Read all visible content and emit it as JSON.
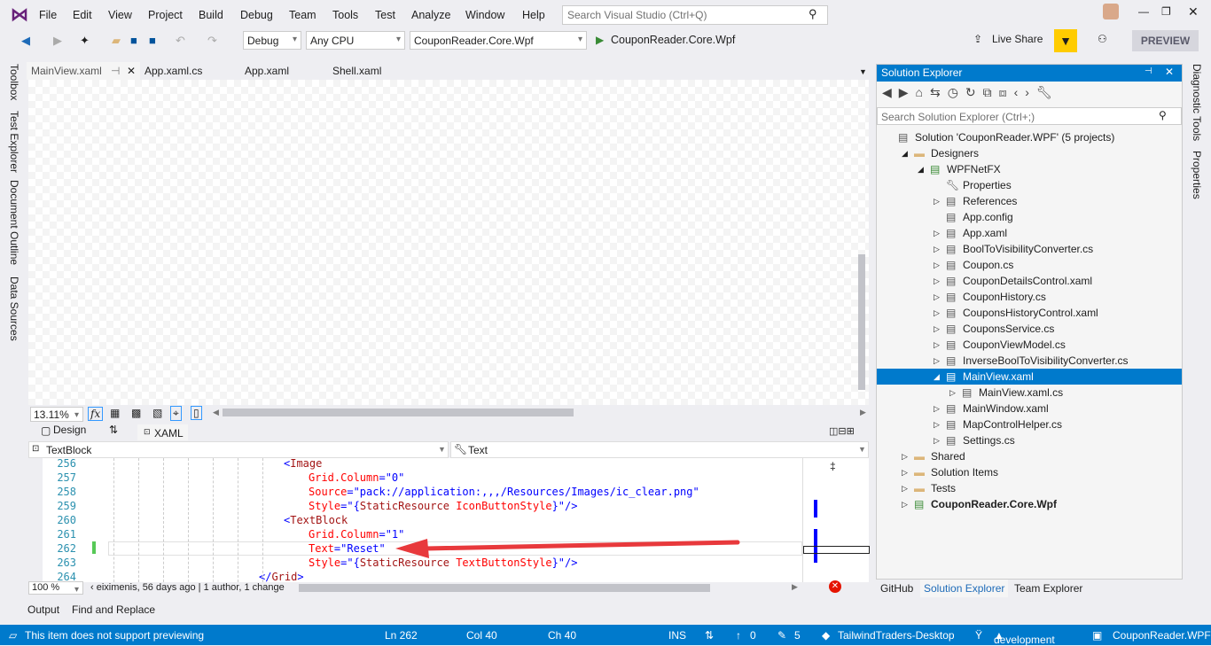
{
  "menu": {
    "items": [
      "File",
      "Edit",
      "View",
      "Project",
      "Build",
      "Debug",
      "Team",
      "Tools",
      "Test",
      "Analyze",
      "Window",
      "Help"
    ],
    "search_placeholder": "Search Visual Studio (Ctrl+Q)"
  },
  "toolbar": {
    "config": "Debug",
    "platform": "Any CPU",
    "startup": "CouponReader.Core.Wpf",
    "run_label": "CouponReader.Core.Wpf",
    "live_share": "Live Share",
    "preview": "PREVIEW"
  },
  "left_tabs": [
    "Toolbox",
    "Test Explorer",
    "Document Outline",
    "Data Sources"
  ],
  "right_tabs": [
    "Diagnostic Tools",
    "Properties"
  ],
  "doc_tabs": [
    "MainView.xaml",
    "App.xaml.cs",
    "App.xaml",
    "Shell.xaml"
  ],
  "designer": {
    "zoom": "13.11%",
    "design_tab": "Design",
    "xaml_tab": "XAML",
    "nav_left": "TextBlock",
    "nav_right": "Text"
  },
  "code": {
    "lines": [
      {
        "n": "256",
        "ind": 0,
        "seg": [
          [
            "br",
            "<"
          ],
          [
            "tag",
            "Image"
          ]
        ]
      },
      {
        "n": "257",
        "ind": 1,
        "seg": [
          [
            "attr",
            "Grid.Column"
          ],
          [
            "br",
            "=\"0\""
          ]
        ]
      },
      {
        "n": "258",
        "ind": 1,
        "seg": [
          [
            "attr",
            "Source"
          ],
          [
            "br",
            "=\"pack://application:,,,/Resources/Images/ic_clear.png\""
          ]
        ]
      },
      {
        "n": "259",
        "ind": 1,
        "seg": [
          [
            "attr",
            "Style"
          ],
          [
            "br",
            "=\"{"
          ],
          [
            "tag",
            "StaticResource"
          ],
          [
            "attr",
            " IconButtonStyle"
          ],
          [
            "br",
            "}\"/>"
          ]
        ]
      },
      {
        "n": "260",
        "ind": 0,
        "seg": [
          [
            "br",
            "<"
          ],
          [
            "tag",
            "TextBlock"
          ]
        ]
      },
      {
        "n": "261",
        "ind": 1,
        "seg": [
          [
            "attr",
            "Grid.Column"
          ],
          [
            "br",
            "=\"1\""
          ]
        ]
      },
      {
        "n": "262",
        "ind": 1,
        "seg": [
          [
            "attr",
            "Text"
          ],
          [
            "br",
            "=\"Reset\""
          ]
        ]
      },
      {
        "n": "263",
        "ind": 1,
        "seg": [
          [
            "attr",
            "Style"
          ],
          [
            "br",
            "=\"{"
          ],
          [
            "tag",
            "StaticResource"
          ],
          [
            "attr",
            " TextButtonStyle"
          ],
          [
            "br",
            "}\"/>"
          ]
        ]
      },
      {
        "n": "264",
        "ind": -1,
        "seg": [
          [
            "br",
            "</"
          ],
          [
            "tag",
            "Grid"
          ],
          [
            "br",
            ">"
          ]
        ]
      }
    ],
    "zoom": "100 %",
    "blame": "eiximenis, 56 days ago | 1 author, 1 change"
  },
  "bottom_tabs": [
    "Output",
    "Find and Replace"
  ],
  "solution_explorer": {
    "title": "Solution Explorer",
    "search_placeholder": "Search Solution Explorer (Ctrl+;)",
    "tree": [
      {
        "label": "Solution 'CouponReader.WPF' (5 projects)",
        "lvl": 0,
        "icon": "solution-icon"
      },
      {
        "label": "Designers",
        "lvl": 1,
        "exp": "open",
        "icon": "folder-icon"
      },
      {
        "label": "WPFNetFX",
        "lvl": 2,
        "exp": "open",
        "icon": "csharp-project-icon"
      },
      {
        "label": "Properties",
        "lvl": 3,
        "icon": "wrench-icon"
      },
      {
        "label": "References",
        "lvl": 3,
        "exp": "closed",
        "icon": "references-icon"
      },
      {
        "label": "App.config",
        "lvl": 3,
        "icon": "config-icon"
      },
      {
        "label": "App.xaml",
        "lvl": 3,
        "exp": "closed",
        "icon": "xaml-icon"
      },
      {
        "label": "BoolToVisibilityConverter.cs",
        "lvl": 3,
        "exp": "closed",
        "icon": "cs-file-icon"
      },
      {
        "label": "Coupon.cs",
        "lvl": 3,
        "exp": "closed",
        "icon": "cs-file-icon"
      },
      {
        "label": "CouponDetailsControl.xaml",
        "lvl": 3,
        "exp": "closed",
        "icon": "xaml-icon"
      },
      {
        "label": "CouponHistory.cs",
        "lvl": 3,
        "exp": "closed",
        "icon": "cs-file-icon"
      },
      {
        "label": "CouponsHistoryControl.xaml",
        "lvl": 3,
        "exp": "closed",
        "icon": "xaml-icon"
      },
      {
        "label": "CouponsService.cs",
        "lvl": 3,
        "exp": "closed",
        "icon": "cs-file-icon"
      },
      {
        "label": "CouponViewModel.cs",
        "lvl": 3,
        "exp": "closed",
        "icon": "cs-file-icon"
      },
      {
        "label": "InverseBoolToVisibilityConverter.cs",
        "lvl": 3,
        "exp": "closed",
        "icon": "cs-file-icon"
      },
      {
        "label": "MainView.xaml",
        "lvl": 3,
        "exp": "open",
        "icon": "xaml-icon",
        "selected": true
      },
      {
        "label": "MainView.xaml.cs",
        "lvl": 4,
        "exp": "closed",
        "icon": "cs-file-icon"
      },
      {
        "label": "MainWindow.xaml",
        "lvl": 3,
        "exp": "closed",
        "icon": "xaml-icon"
      },
      {
        "label": "MapControlHelper.cs",
        "lvl": 3,
        "exp": "closed",
        "icon": "cs-file-icon"
      },
      {
        "label": "Settings.cs",
        "lvl": 3,
        "exp": "closed",
        "icon": "cs-file-icon"
      },
      {
        "label": "Shared",
        "lvl": 1,
        "exp": "closed",
        "icon": "folder-icon"
      },
      {
        "label": "Solution Items",
        "lvl": 1,
        "exp": "closed",
        "icon": "folder-icon"
      },
      {
        "label": "Tests",
        "lvl": 1,
        "exp": "closed",
        "icon": "folder-icon"
      },
      {
        "label": "CouponReader.Core.Wpf",
        "lvl": 1,
        "exp": "closed",
        "icon": "csharp-project-icon",
        "bold": true
      }
    ],
    "tabs": [
      "GitHub",
      "Solution Explorer",
      "Team Explorer"
    ]
  },
  "status": {
    "message": "This item does not support previewing",
    "ln": "Ln 262",
    "col": "Col 40",
    "ch": "Ch 40",
    "mode": "INS",
    "push": "0",
    "changes": "5",
    "repo": "TailwindTraders-Desktop",
    "branch": "development",
    "project": "CouponReader.WPF"
  },
  "colors": {
    "accent": "#007acc",
    "arrow": "#e8393c"
  }
}
